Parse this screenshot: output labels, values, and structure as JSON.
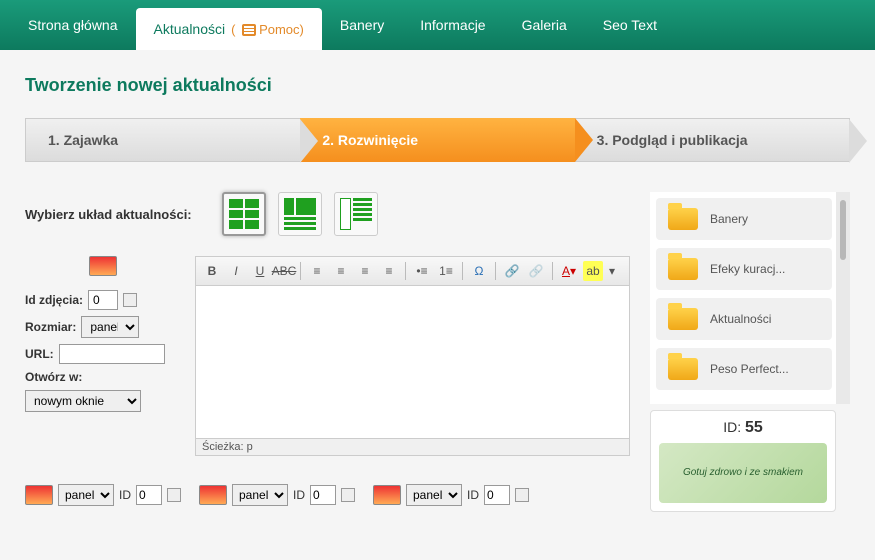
{
  "nav": {
    "items": [
      "Strona główna",
      "Aktualności",
      "Banery",
      "Informacje",
      "Galeria",
      "Seo Text"
    ],
    "help_label": "Pomoc"
  },
  "page_title": "Tworzenie nowej aktualności",
  "wizard": {
    "step1": "1. Zajawka",
    "step2": "2. Rozwinięcie",
    "step3": "3. Podgląd i publikacja"
  },
  "layout_label": "Wybierz układ aktualności:",
  "img_props": {
    "id_label": "Id zdjęcia:",
    "id_value": "0",
    "size_label": "Rozmiar:",
    "size_value": "panel",
    "url_label": "URL:",
    "url_value": "",
    "open_label": "Otwórz w:",
    "open_value": "nowym oknie"
  },
  "editor": {
    "path_label": "Ścieżka: p"
  },
  "bottom": {
    "size": "panel",
    "id_label": "ID",
    "id_value": "0"
  },
  "folders": [
    "Banery",
    "Efeky kuracj...",
    "Aktualności",
    "Peso Perfect..."
  ],
  "asset": {
    "id_label": "ID:",
    "id_value": "55",
    "caption": "Gotuj zdrowo i ze smakiem"
  }
}
